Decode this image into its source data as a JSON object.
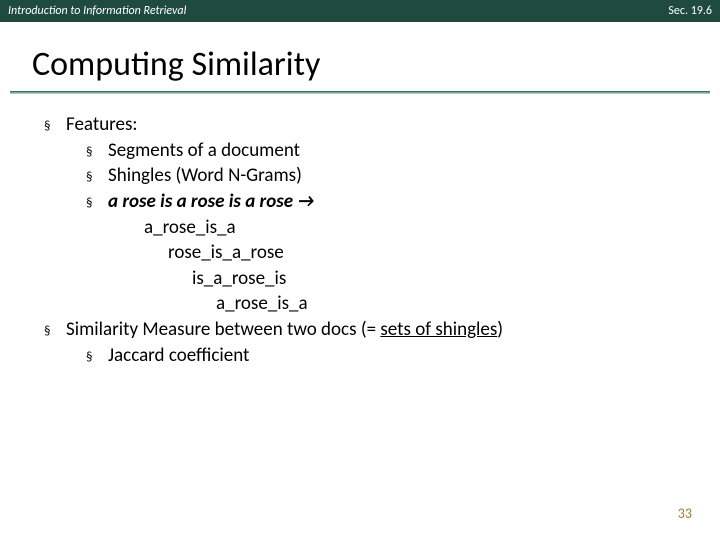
{
  "header": {
    "left": "Introduction to Information Retrieval",
    "right": "Sec. 19.6"
  },
  "title": "Computing Similarity",
  "bullets": {
    "features": "Features:",
    "segments": "Segments of a document",
    "shingles": "Shingles (Word N-Grams)",
    "rose_example": "a rose is a rose is a rose →",
    "sh1": "a_rose_is_a",
    "sh2": "rose_is_a_rose",
    "sh3": "is_a_rose_is",
    "sh4": "a_rose_is_a",
    "similarity_pre": "Similarity Measure between two docs (= ",
    "similarity_underlined": "sets of shingles",
    "similarity_post": ")",
    "jaccard": "Jaccard coefficient"
  },
  "page_number": "33",
  "bullet_char": "§"
}
